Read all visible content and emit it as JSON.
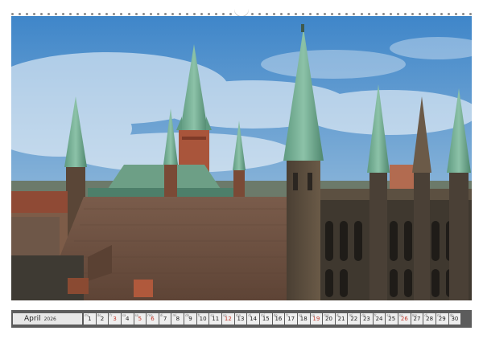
{
  "calendar": {
    "month": "April",
    "year": "2026",
    "days": [
      {
        "n": "1",
        "w": "mi",
        "hol": false
      },
      {
        "n": "2",
        "w": "do",
        "hol": false
      },
      {
        "n": "3",
        "w": "fr",
        "hol": true
      },
      {
        "n": "4",
        "w": "sa",
        "hol": false
      },
      {
        "n": "5",
        "w": "so",
        "hol": true
      },
      {
        "n": "6",
        "w": "mo",
        "hol": true
      },
      {
        "n": "7",
        "w": "di",
        "hol": false
      },
      {
        "n": "8",
        "w": "mi",
        "hol": false
      },
      {
        "n": "9",
        "w": "do",
        "hol": false
      },
      {
        "n": "10",
        "w": "fr",
        "hol": false
      },
      {
        "n": "11",
        "w": "sa",
        "hol": false
      },
      {
        "n": "12",
        "w": "so",
        "hol": true
      },
      {
        "n": "13",
        "w": "mo",
        "hol": false
      },
      {
        "n": "14",
        "w": "di",
        "hol": false
      },
      {
        "n": "15",
        "w": "mi",
        "hol": false
      },
      {
        "n": "16",
        "w": "do",
        "hol": false
      },
      {
        "n": "17",
        "w": "fr",
        "hol": false
      },
      {
        "n": "18",
        "w": "sa",
        "hol": false
      },
      {
        "n": "19",
        "w": "so",
        "hol": true
      },
      {
        "n": "20",
        "w": "mo",
        "hol": false
      },
      {
        "n": "21",
        "w": "di",
        "hol": false
      },
      {
        "n": "22",
        "w": "mi",
        "hol": false
      },
      {
        "n": "23",
        "w": "do",
        "hol": false
      },
      {
        "n": "24",
        "w": "fr",
        "hol": false
      },
      {
        "n": "25",
        "w": "sa",
        "hol": false
      },
      {
        "n": "26",
        "w": "so",
        "hol": true
      },
      {
        "n": "27",
        "w": "mo",
        "hol": false
      },
      {
        "n": "28",
        "w": "di",
        "hol": false
      },
      {
        "n": "29",
        "w": "mi",
        "hol": false
      },
      {
        "n": "30",
        "w": "do",
        "hol": false
      }
    ]
  },
  "colors": {
    "holiday": "#c0392b",
    "sky_top": "#3f86c9",
    "sky_bottom": "#bcd3e6",
    "roof": "#7b5a48",
    "copper": "#6fa88c",
    "brick": "#8a4a32"
  }
}
